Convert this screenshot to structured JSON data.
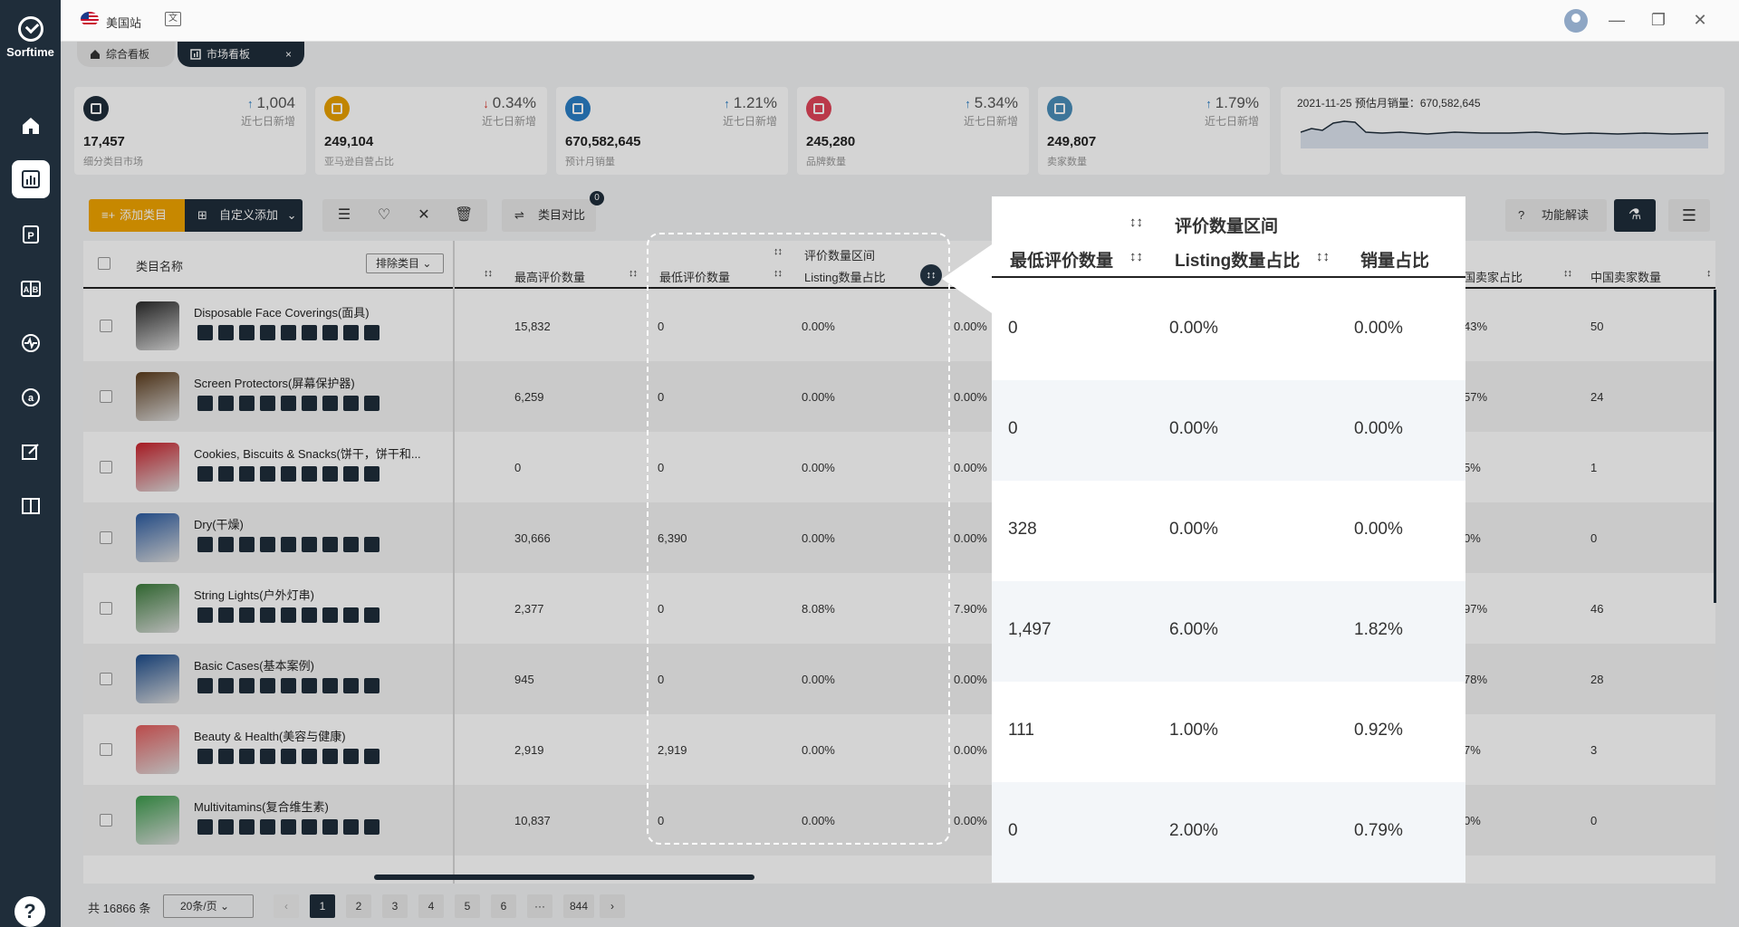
{
  "app": {
    "name": "Sorftime",
    "help": "?"
  },
  "topbar": {
    "site": "美国站",
    "translate_icon": "文"
  },
  "tabs": [
    {
      "label": "综合看板"
    },
    {
      "label": "市场看板",
      "close": "×"
    }
  ],
  "stats": [
    {
      "value": "17,457",
      "label": "细分类目市场",
      "delta": "1,004",
      "dir": "↑",
      "sub": "近七日新增",
      "color": "#1f2d3a"
    },
    {
      "value": "249,104",
      "label": "亚马逊自营占比",
      "delta": "0.34%",
      "dir": "↓",
      "sub": "近七日新增",
      "color": "#e8a100"
    },
    {
      "value": "670,582,645",
      "label": "预计月销量",
      "delta": "1.21%",
      "dir": "↑",
      "sub": "近七日新增",
      "color": "#2b7fc6"
    },
    {
      "value": "245,280",
      "label": "品牌数量",
      "delta": "5.34%",
      "dir": "↑",
      "sub": "近七日新增",
      "color": "#e0455a"
    },
    {
      "value": "249,807",
      "label": "卖家数量",
      "delta": "1.79%",
      "dir": "↑",
      "sub": "近七日新增",
      "color": "#4a8db8"
    }
  ],
  "chart_card": {
    "caption": "2021-11-25 预估月销量：670,582,645"
  },
  "toolbar": {
    "add_label": "添加类目",
    "custom_label": "自定义添加",
    "compare_label": "类目对比",
    "compare_badge": "0",
    "help_label": "功能解读"
  },
  "table": {
    "headers": {
      "name": "类目名称",
      "exclude": "排除类目",
      "max_reviews": "最高评价数量",
      "min_reviews": "最低评价数量",
      "review_range": "评价数量区间",
      "listing_share": "Listing数量占比",
      "sales_share": "销量占比",
      "cn_seller_share": "国卖家占比",
      "cn_seller_count": "中国卖家数量"
    },
    "rows": [
      {
        "name": "Disposable Face Coverings(面具)",
        "max": "15,832",
        "min": "0",
        "listing": "0.00%",
        "sales": "0.00%",
        "cn_share": "43%",
        "cn_count": "50",
        "img": "#2a2a2a"
      },
      {
        "name": "Screen Protectors(屏幕保护器)",
        "max": "6,259",
        "min": "0",
        "listing": "0.00%",
        "sales": "0.00%",
        "cn_share": "57%",
        "cn_count": "24",
        "img": "#5a3a1a"
      },
      {
        "name": "Cookies, Biscuits & Snacks(饼干，饼干和...",
        "max": "0",
        "min": "0",
        "listing": "0.00%",
        "sales": "0.00%",
        "cn_share": "5%",
        "cn_count": "1",
        "img": "#c8202a"
      },
      {
        "name": "Dry(干燥)",
        "max": "30,666",
        "min": "6,390",
        "listing": "0.00%",
        "sales": "0.00%",
        "cn_share": "0%",
        "cn_count": "0",
        "img": "#2a5aa0"
      },
      {
        "name": "String Lights(户外灯串)",
        "max": "2,377",
        "min": "0",
        "listing": "8.08%",
        "sales": "7.90%",
        "cn_share": "97%",
        "cn_count": "46",
        "img": "#3a7a3a"
      },
      {
        "name": "Basic Cases(基本案例)",
        "max": "945",
        "min": "0",
        "listing": "0.00%",
        "sales": "0.00%",
        "cn_share": "78%",
        "cn_count": "28",
        "img": "#1a4a8a"
      },
      {
        "name": "Beauty & Health(美容与健康)",
        "max": "2,919",
        "min": "2,919",
        "listing": "0.00%",
        "sales": "0.00%",
        "cn_share": "7%",
        "cn_count": "3",
        "img": "#e05a5a"
      },
      {
        "name": "Multivitamins(复合维生素)",
        "max": "10,837",
        "min": "0",
        "listing": "0.00%",
        "sales": "0.00%",
        "cn_share": "0%",
        "cn_count": "0",
        "img": "#3a9a4a"
      }
    ]
  },
  "zoom": {
    "headers": {
      "min_reviews": "最低评价数量",
      "review_range": "评价数量区间",
      "listing_share": "Listing数量占比",
      "sales_share": "销量占比"
    },
    "rows": [
      {
        "min": "0",
        "listing": "0.00%",
        "sales": "0.00%"
      },
      {
        "min": "0",
        "listing": "0.00%",
        "sales": "0.00%"
      },
      {
        "min": "328",
        "listing": "0.00%",
        "sales": "0.00%"
      },
      {
        "min": "1,497",
        "listing": "6.00%",
        "sales": "1.82%"
      },
      {
        "min": "111",
        "listing": "1.00%",
        "sales": "0.92%"
      },
      {
        "min": "0",
        "listing": "2.00%",
        "sales": "0.79%"
      }
    ]
  },
  "pager": {
    "total": "共 16866 条",
    "page_size": "20条/页",
    "prev": "‹",
    "next": "›",
    "pages": [
      "1",
      "2",
      "3",
      "4",
      "5",
      "6",
      "···",
      "844"
    ]
  }
}
